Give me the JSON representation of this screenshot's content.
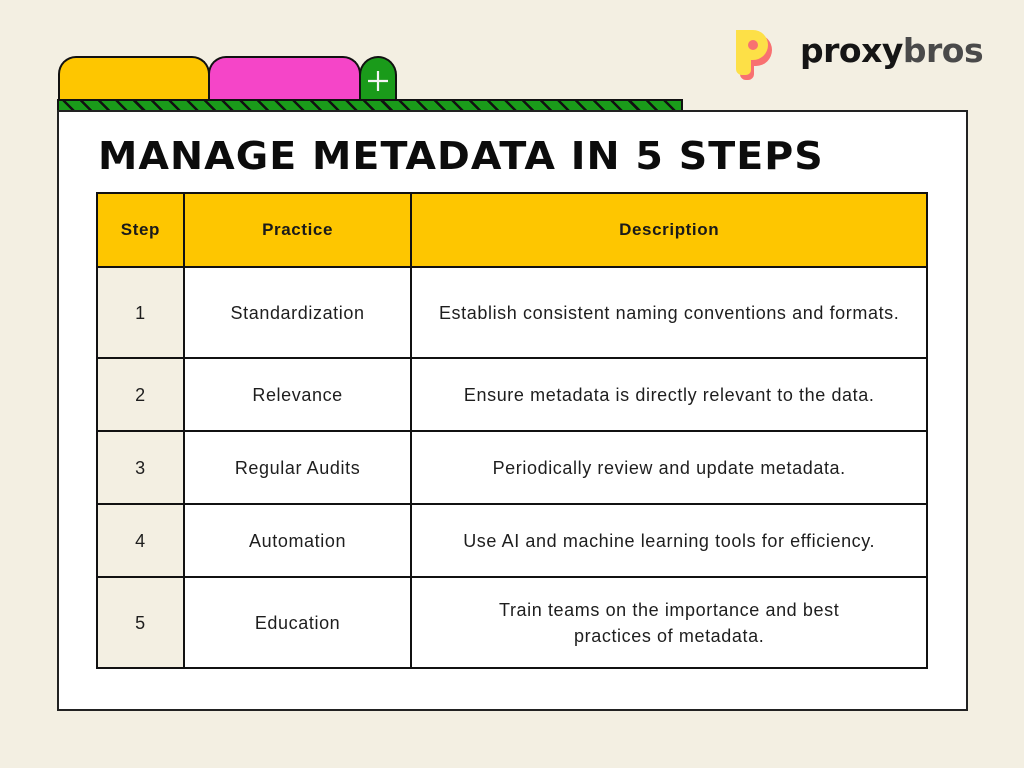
{
  "brand": {
    "name_part1": "proxy",
    "name_part2": "bros",
    "colors": {
      "primary": "#fde047",
      "shadow": "#f87171"
    }
  },
  "tabs": [
    {
      "color": "#fec600"
    },
    {
      "color": "#f545c8"
    },
    {
      "icon": "plus-icon",
      "color": "#1a9b1a"
    }
  ],
  "title": "MANAGE METADATA IN 5 STEPS",
  "table": {
    "headers": [
      "Step",
      "Practice",
      "Description"
    ],
    "rows": [
      {
        "step": "1",
        "practice": "Standardization",
        "description": "Establish consistent naming conventions and formats."
      },
      {
        "step": "2",
        "practice": "Relevance",
        "description": "Ensure metadata is directly relevant to the data."
      },
      {
        "step": "3",
        "practice": "Regular Audits",
        "description": "Periodically review and update metadata."
      },
      {
        "step": "4",
        "practice": "Automation",
        "description": "Use AI and machine learning tools for efficiency."
      },
      {
        "step": "5",
        "practice": "Education",
        "description": "Train teams on the importance and best practices of metadata."
      }
    ]
  },
  "colors": {
    "background": "#f3efe2",
    "header": "#fec600",
    "accent_pink": "#f545c8",
    "accent_green": "#1a9b1a"
  }
}
